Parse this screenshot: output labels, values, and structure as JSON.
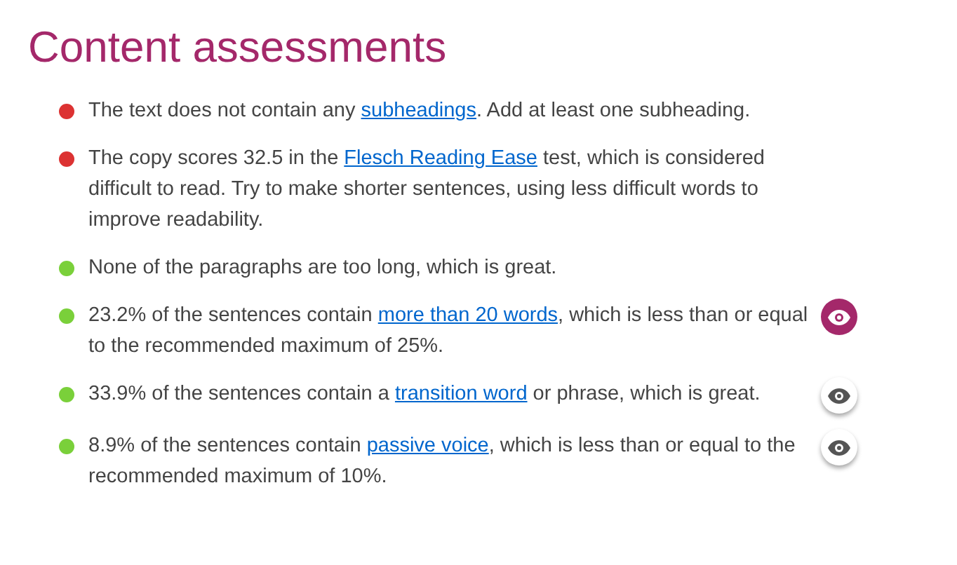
{
  "title": "Content assessments",
  "items": [
    {
      "color": "#dc3232",
      "parts": [
        {
          "kind": "text",
          "text": "The text does not contain any "
        },
        {
          "kind": "link",
          "text": "subheadings"
        },
        {
          "kind": "text",
          "text": ". Add at least one subheading."
        }
      ]
    },
    {
      "color": "#dc3232",
      "parts": [
        {
          "kind": "text",
          "text": "The copy scores 32.5 in the "
        },
        {
          "kind": "link",
          "text": "Flesch Reading Ease"
        },
        {
          "kind": "text",
          "text": " test, which is considered difficult to read. Try to make shorter sentences, using less difficult words to improve readability."
        }
      ]
    },
    {
      "color": "#7ad03a",
      "parts": [
        {
          "kind": "text",
          "text": "None of the paragraphs are too long, which is great."
        }
      ]
    },
    {
      "color": "#7ad03a",
      "parts": [
        {
          "kind": "text",
          "text": "23.2% of the sentences contain "
        },
        {
          "kind": "link",
          "text": "more than 20 words"
        },
        {
          "kind": "text",
          "text": ", which is less than or equal to the recommended maximum of 25%."
        }
      ],
      "eye": {
        "selected": true
      }
    },
    {
      "color": "#7ad03a",
      "parts": [
        {
          "kind": "text",
          "text": "33.9% of the sentences contain a "
        },
        {
          "kind": "link",
          "text": "transition word"
        },
        {
          "kind": "text",
          "text": " or phrase, which is great."
        }
      ],
      "eye": {
        "selected": false
      }
    },
    {
      "color": "#7ad03a",
      "parts": [
        {
          "kind": "text",
          "text": "8.9% of the sentences contain "
        },
        {
          "kind": "link",
          "text": "passive voice"
        },
        {
          "kind": "text",
          "text": ", which is less than or equal to the recommended maximum of 10%."
        }
      ],
      "eye": {
        "selected": false
      }
    }
  ]
}
